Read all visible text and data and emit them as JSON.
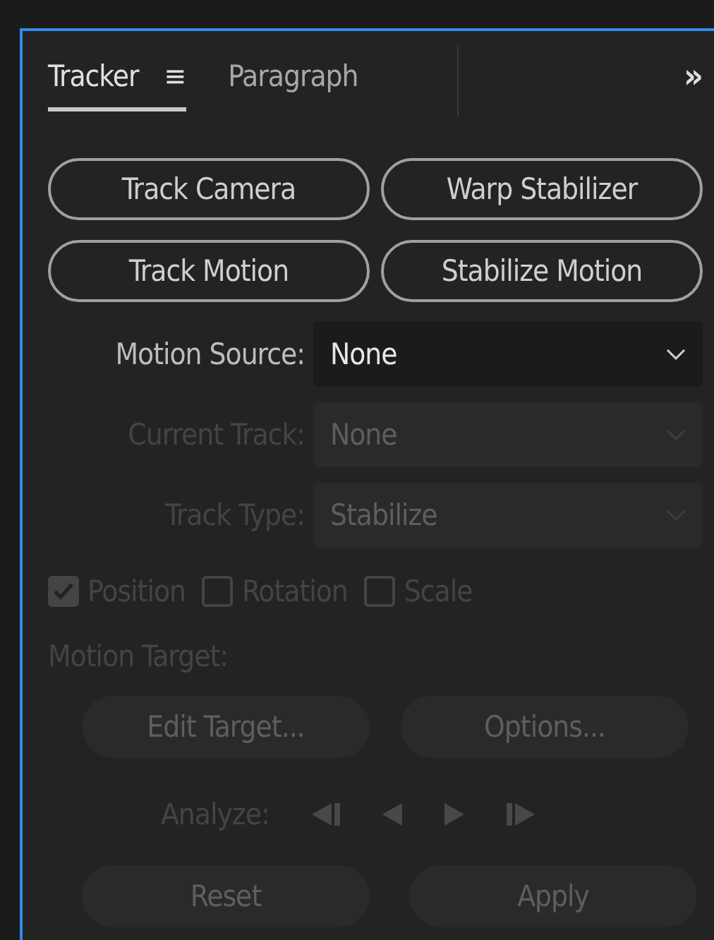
{
  "tabs": [
    {
      "label": "Tracker",
      "selected": true,
      "menu": "≡"
    },
    {
      "label": "Paragraph",
      "selected": false
    }
  ],
  "overflow": "»",
  "track_buttons": [
    {
      "label": "Track Camera"
    },
    {
      "label": "Warp Stabilizer"
    },
    {
      "label": "Track Motion"
    },
    {
      "label": "Stabilize Motion"
    }
  ],
  "dropdowns": [
    {
      "label": "Motion Source:",
      "value": "None",
      "disabled": false
    },
    {
      "label": "Current Track:",
      "value": "None",
      "disabled": true
    },
    {
      "label": "Track Type:",
      "value": "Stabilize",
      "disabled": true
    }
  ],
  "checkboxes": [
    {
      "label": "Position",
      "checked": true,
      "disabled": true
    },
    {
      "label": "Rotation",
      "checked": false,
      "disabled": true
    },
    {
      "label": "Scale",
      "checked": false,
      "disabled": true
    }
  ],
  "motion_target": {
    "label": "Motion Target:",
    "disabled": true
  },
  "target_buttons": [
    {
      "label": "Edit Target...",
      "disabled": true
    },
    {
      "label": "Options...",
      "disabled": true
    }
  ],
  "analyze": {
    "label": "Analyze:",
    "disabled": true,
    "controls": [
      {
        "kind": "step-back"
      },
      {
        "kind": "back"
      },
      {
        "kind": "forward"
      },
      {
        "kind": "step-forward"
      }
    ]
  },
  "action_buttons": [
    {
      "label": "Reset",
      "disabled": true
    },
    {
      "label": "Apply",
      "disabled": true
    }
  ]
}
